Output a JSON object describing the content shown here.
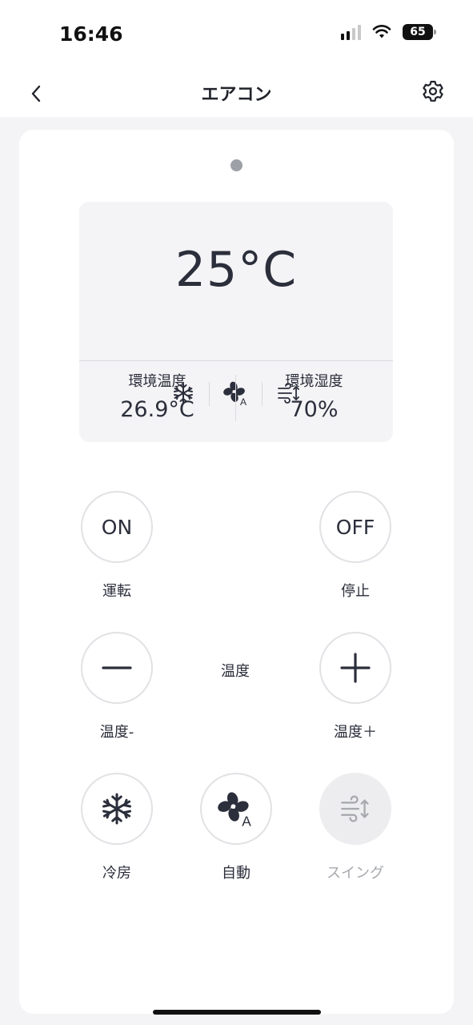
{
  "status_bar": {
    "time": "16:46",
    "battery": "65"
  },
  "nav": {
    "title": "エアコン",
    "back_icon": "chevron-left-icon",
    "settings_icon": "gear-icon"
  },
  "panel": {
    "set_temperature": "25°C",
    "mode_icons": [
      "snowflake-icon",
      "fan-auto-icon",
      "swing-icon"
    ],
    "ambient_temperature": {
      "label": "環境温度",
      "value": "26.9°C"
    },
    "ambient_humidity": {
      "label": "環境湿度",
      "value": "70%"
    }
  },
  "controls": {
    "on": {
      "text": "ON",
      "label": "運転"
    },
    "off": {
      "text": "OFF",
      "label": "停止"
    },
    "temp_down": {
      "label": "温度-"
    },
    "temp_center_label": "温度",
    "temp_up": {
      "label": "温度＋"
    },
    "cool": {
      "label": "冷房"
    },
    "auto": {
      "label": "自動"
    },
    "swing": {
      "label": "スイング",
      "enabled": false
    }
  },
  "colors": {
    "text": "#2b2e3b",
    "panel_bg": "#f4f4f6",
    "disabled": "#a7a9ae"
  }
}
